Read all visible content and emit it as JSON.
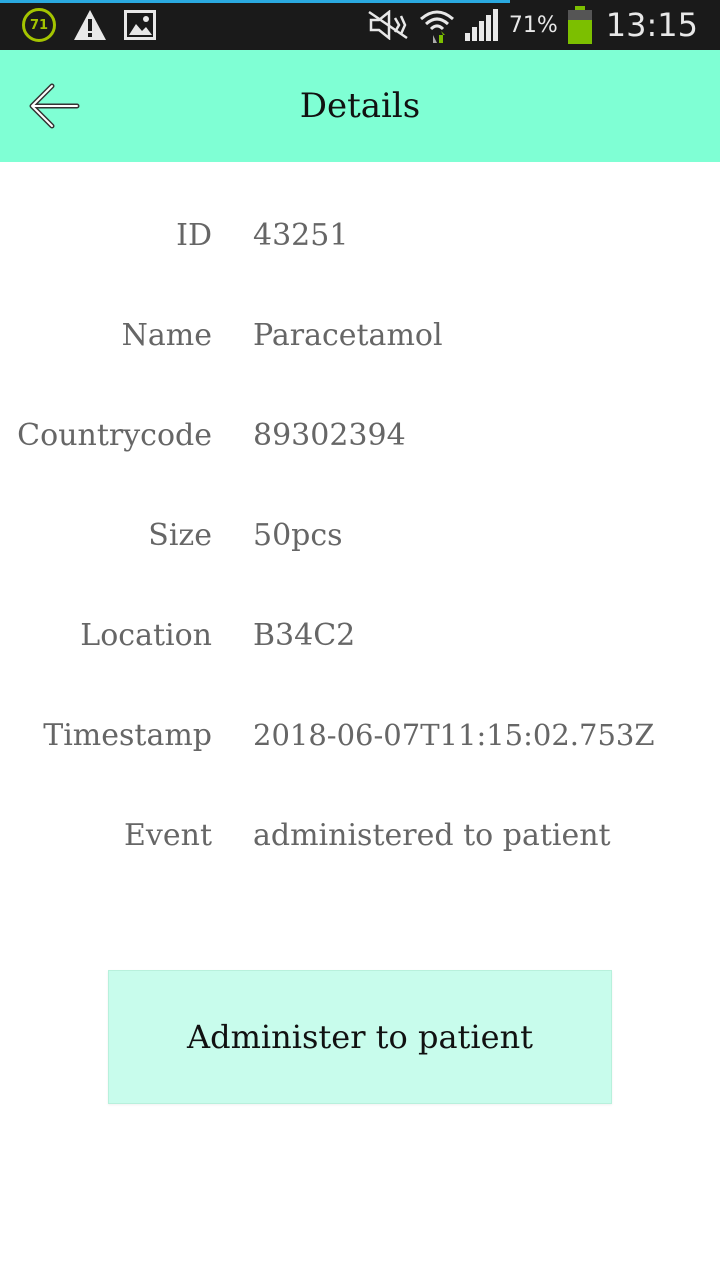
{
  "status_bar": {
    "notification_badge": "71",
    "battery_percent": "71%",
    "time": "13:15",
    "colors": {
      "background": "#1a1a1a",
      "badge": "#a4c400",
      "battery": "#7cbf00",
      "progress": "#2aa9e0"
    },
    "icons": [
      "badge-icon",
      "warning-icon",
      "image-icon",
      "mute-icon",
      "wifi-icon",
      "signal-icon",
      "battery-icon"
    ]
  },
  "app_bar": {
    "title": "Details",
    "back_icon": "arrow-left-icon",
    "color": "#7fffd4"
  },
  "details": [
    {
      "label": "ID",
      "value": "43251"
    },
    {
      "label": "Name",
      "value": "Paracetamol"
    },
    {
      "label": "Countrycode",
      "value": "89302394"
    },
    {
      "label": "Size",
      "value": "50pcs"
    },
    {
      "label": "Location",
      "value": "B34C2"
    },
    {
      "label": "Timestamp",
      "value": "2018-06-07T11:15:02.753Z"
    },
    {
      "label": "Event",
      "value": "administered to patient"
    }
  ],
  "action": {
    "label": "Administer to patient",
    "color": "#c8fcec"
  }
}
